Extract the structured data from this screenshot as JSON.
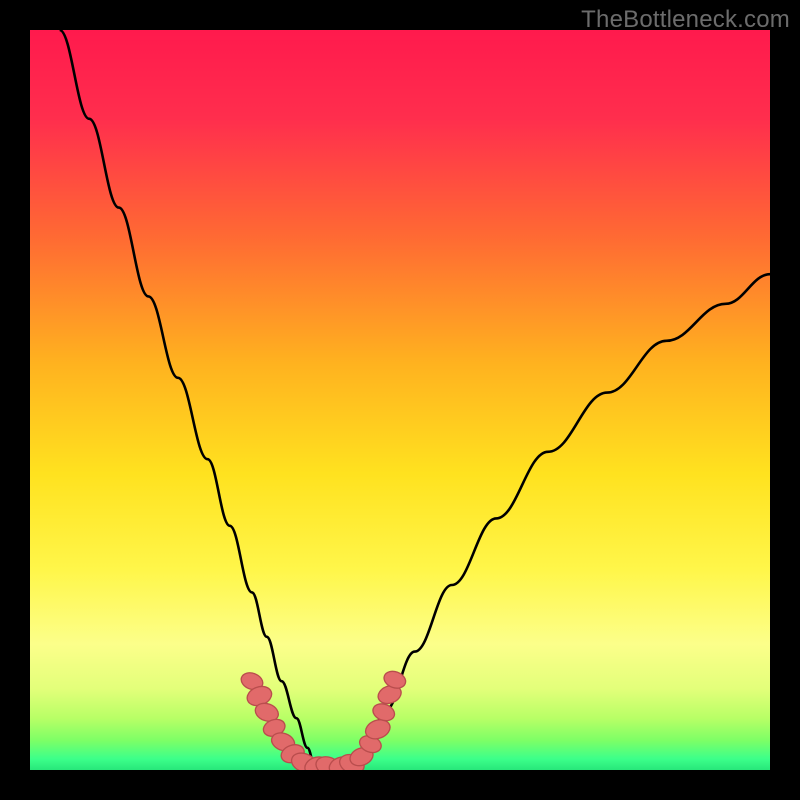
{
  "watermark": "TheBottleneck.com",
  "colors": {
    "frame": "#000000",
    "curve_stroke": "#000000",
    "chain_fill": "#e16a6a",
    "chain_stroke": "#b94d4d",
    "gradient_stops": [
      {
        "offset": 0.0,
        "color": "#ff1a4d"
      },
      {
        "offset": 0.12,
        "color": "#ff2e4d"
      },
      {
        "offset": 0.28,
        "color": "#ff6a33"
      },
      {
        "offset": 0.45,
        "color": "#ffb21f"
      },
      {
        "offset": 0.6,
        "color": "#ffe21f"
      },
      {
        "offset": 0.73,
        "color": "#fff64a"
      },
      {
        "offset": 0.83,
        "color": "#fcff8a"
      },
      {
        "offset": 0.89,
        "color": "#e3ff7a"
      },
      {
        "offset": 0.93,
        "color": "#b8ff66"
      },
      {
        "offset": 0.96,
        "color": "#7dff66"
      },
      {
        "offset": 0.985,
        "color": "#3cff8a"
      },
      {
        "offset": 1.0,
        "color": "#28e77a"
      }
    ]
  },
  "chart_data": {
    "type": "line",
    "title": "",
    "xlabel": "",
    "ylabel": "",
    "xlim": [
      0,
      100
    ],
    "ylim": [
      0,
      100
    ],
    "grid": false,
    "series": [
      {
        "name": "left-curve",
        "x": [
          4,
          8,
          12,
          16,
          20,
          24,
          27,
          30,
          32,
          34,
          36,
          37.5,
          38.5
        ],
        "y": [
          100,
          88,
          76,
          64,
          53,
          42,
          33,
          24,
          18,
          12,
          7,
          3,
          0.5
        ]
      },
      {
        "name": "right-curve",
        "x": [
          44,
          45.5,
          48,
          52,
          57,
          63,
          70,
          78,
          86,
          94,
          100
        ],
        "y": [
          0.5,
          3,
          8,
          16,
          25,
          34,
          43,
          51,
          58,
          63,
          67
        ]
      },
      {
        "name": "bottom-flat",
        "x": [
          38.5,
          44
        ],
        "y": [
          0.5,
          0.5
        ]
      }
    ],
    "chain_points": [
      {
        "x": 30.0,
        "y": 12.0,
        "r": 1.5
      },
      {
        "x": 31.0,
        "y": 10.0,
        "r": 1.7
      },
      {
        "x": 32.0,
        "y": 7.8,
        "r": 1.6
      },
      {
        "x": 33.0,
        "y": 5.7,
        "r": 1.5
      },
      {
        "x": 34.2,
        "y": 3.8,
        "r": 1.6
      },
      {
        "x": 35.5,
        "y": 2.2,
        "r": 1.6
      },
      {
        "x": 37.0,
        "y": 1.0,
        "r": 1.7
      },
      {
        "x": 38.7,
        "y": 0.55,
        "r": 1.6
      },
      {
        "x": 40.3,
        "y": 0.5,
        "r": 1.7
      },
      {
        "x": 42.0,
        "y": 0.55,
        "r": 1.6
      },
      {
        "x": 43.5,
        "y": 0.8,
        "r": 1.7
      },
      {
        "x": 44.8,
        "y": 1.8,
        "r": 1.6
      },
      {
        "x": 46.0,
        "y": 3.5,
        "r": 1.5
      },
      {
        "x": 47.0,
        "y": 5.5,
        "r": 1.7
      },
      {
        "x": 47.8,
        "y": 7.8,
        "r": 1.5
      },
      {
        "x": 48.6,
        "y": 10.2,
        "r": 1.6
      },
      {
        "x": 49.3,
        "y": 12.2,
        "r": 1.5
      }
    ]
  }
}
